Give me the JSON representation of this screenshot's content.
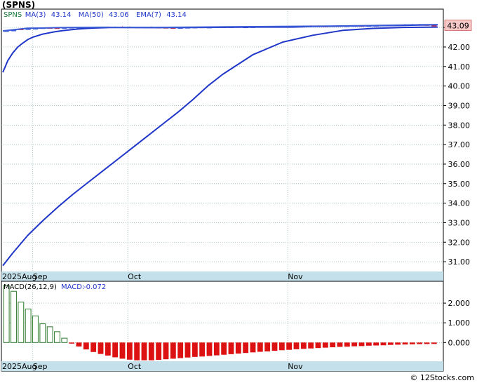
{
  "title": "(SPNS)",
  "footer": "© 12Stocks.com",
  "colors": {
    "panel_border": "#000000",
    "grid": "#7aa6a6",
    "axis_band": "#c4e0ea",
    "ma3": "#3b5bd6",
    "ma50": "#1f36c9",
    "ema7": "#1f36c9",
    "candle_up": "#3b5bd6",
    "candle_down": "#e02020",
    "macd_pos": "#2f7a2f",
    "macd_neg": "#dd1111",
    "legend_text": "#1f36c9",
    "price_tag_bg": "#f6c8c8"
  },
  "chart_data": [
    {
      "type": "line",
      "name": "price",
      "legend": [
        {
          "label": "SPNS",
          "value": ""
        },
        {
          "label": "MA(3)",
          "value": "43.14"
        },
        {
          "label": "MA(50)",
          "value": "43.06"
        },
        {
          "label": "EMA(7)",
          "value": "43.14"
        }
      ],
      "last_price_label": "43.09",
      "last_price": 43.09,
      "ylim": [
        30.5,
        43.4
      ],
      "y_ticks": [
        "43.00",
        "42.00",
        "41.00",
        "40.00",
        "39.00",
        "38.00",
        "37.00",
        "36.00",
        "35.00",
        "34.00",
        "33.00",
        "32.00",
        "31.00"
      ],
      "y_tick_values": [
        43,
        42,
        41,
        40,
        39,
        38,
        37,
        36,
        35,
        34,
        33,
        32,
        31
      ],
      "x_labels": [
        "2025Aug",
        "Sep",
        "Oct",
        "Nov"
      ],
      "x_label_days": [
        0,
        6,
        25,
        57
      ],
      "x_range_days": [
        0,
        87
      ],
      "series": [
        {
          "name": "MA(50)",
          "x": [
            0,
            2,
            5,
            8,
            11,
            14,
            17,
            20,
            23,
            26,
            29,
            32,
            35,
            38,
            41,
            42,
            44,
            50,
            56,
            62,
            68,
            74,
            80,
            87
          ],
          "y": [
            30.8,
            31.45,
            32.35,
            33.1,
            33.8,
            34.45,
            35.05,
            35.65,
            36.25,
            36.85,
            37.45,
            38.05,
            38.65,
            39.3,
            40.0,
            40.2,
            40.6,
            41.6,
            42.25,
            42.6,
            42.85,
            42.95,
            43.0,
            43.02
          ]
        },
        {
          "name": "EMA(7)",
          "x": [
            0,
            0.5,
            1,
            2,
            3,
            4,
            5,
            6,
            7,
            8,
            10,
            12,
            15,
            18,
            22,
            30,
            40,
            50,
            58,
            62,
            66,
            70,
            80,
            87
          ],
          "y": [
            40.7,
            41.0,
            41.3,
            41.7,
            42.0,
            42.2,
            42.38,
            42.5,
            42.58,
            42.66,
            42.76,
            42.84,
            42.92,
            42.97,
            43.0,
            42.99,
            43.0,
            43.02,
            43.02,
            43.05,
            43.06,
            43.08,
            43.1,
            43.14
          ]
        },
        {
          "name": "MA(3)",
          "x": [
            0,
            2,
            5,
            8,
            11,
            15,
            20,
            25,
            30,
            35,
            40,
            45,
            50,
            55,
            60,
            65,
            70,
            75,
            80,
            84,
            87
          ],
          "y": [
            42.82,
            42.88,
            42.96,
            42.97,
            42.99,
            43.0,
            43.01,
            43.0,
            43.0,
            43.01,
            43.02,
            43.03,
            43.04,
            43.05,
            43.06,
            43.07,
            43.08,
            43.1,
            43.12,
            43.14,
            43.14
          ]
        }
      ],
      "candles": {
        "close": [
          42.83,
          42.86,
          42.9,
          42.93,
          42.95,
          42.98,
          42.97,
          42.96,
          42.99,
          43.0,
          43.01,
          42.98,
          43.0,
          43.02,
          43.01,
          43.03,
          43.02,
          43.01,
          43.0,
          43.02,
          43.01,
          42.99,
          42.98,
          42.97,
          42.99,
          43.0,
          43.01,
          43.0,
          43.01,
          43.02,
          43.01,
          43.03,
          43.02,
          43.02,
          43.03,
          43.04,
          43.03,
          43.05,
          43.04,
          43.06,
          43.05,
          43.08,
          43.07,
          43.06,
          43.05,
          43.08,
          43.07,
          43.08,
          43.09,
          43.07,
          43.09,
          43.1,
          43.12,
          43.11,
          43.13,
          43.15,
          43.16,
          43.14,
          43.12,
          43.09
        ],
        "up": [
          true,
          true,
          false,
          true,
          true,
          true,
          false,
          false,
          true,
          true,
          true,
          false,
          true,
          true,
          false,
          true,
          false,
          false,
          false,
          true,
          false,
          false,
          false,
          false,
          true,
          true,
          true,
          false,
          true,
          true,
          false,
          true,
          false,
          true,
          true,
          true,
          false,
          true,
          false,
          true,
          false,
          true,
          false,
          false,
          false,
          true,
          false,
          true,
          true,
          false,
          true,
          true,
          true,
          false,
          true,
          true,
          true,
          false,
          false,
          false
        ]
      }
    },
    {
      "type": "bar",
      "name": "macd",
      "legend": [
        {
          "label": "MACD(26,12,9)",
          "value": ""
        },
        {
          "label": "MACD:",
          "value": "-0.072"
        }
      ],
      "ylim": [
        -0.95,
        3.0
      ],
      "y_ticks": [
        "2.000",
        "1.000",
        "0.000"
      ],
      "y_tick_values": [
        2,
        1,
        0
      ],
      "x_labels": [
        "2025Aug",
        "Sep",
        "Oct",
        "Nov"
      ],
      "x_label_days": [
        0,
        6,
        25,
        57
      ],
      "x_range_days": [
        0,
        87
      ],
      "values": [
        2.9,
        2.6,
        2.05,
        1.7,
        1.35,
        0.95,
        0.8,
        0.55,
        0.22,
        -0.05,
        -0.2,
        -0.35,
        -0.48,
        -0.58,
        -0.66,
        -0.75,
        -0.82,
        -0.87,
        -0.9,
        -0.9,
        -0.9,
        -0.88,
        -0.85,
        -0.82,
        -0.79,
        -0.76,
        -0.73,
        -0.71,
        -0.68,
        -0.65,
        -0.62,
        -0.59,
        -0.56,
        -0.53,
        -0.5,
        -0.47,
        -0.45,
        -0.42,
        -0.39,
        -0.37,
        -0.34,
        -0.32,
        -0.3,
        -0.28,
        -0.26,
        -0.24,
        -0.22,
        -0.21,
        -0.19,
        -0.18,
        -0.16,
        -0.15,
        -0.14,
        -0.12,
        -0.11,
        -0.1,
        -0.09,
        -0.08,
        -0.075,
        -0.072
      ]
    }
  ]
}
